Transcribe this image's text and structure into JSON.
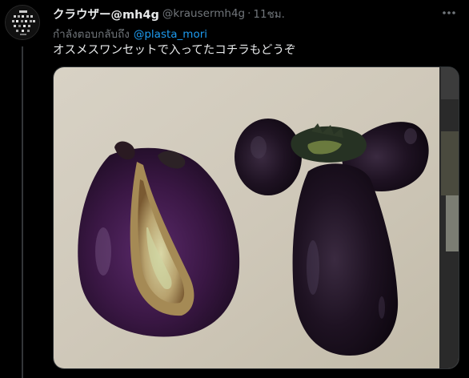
{
  "tweet": {
    "display_name": "クラウザー@mh4g",
    "handle": "@krausermh4g",
    "separator": "·",
    "time": "11ชม.",
    "reply_prefix": "กำลังตอบกลับถึง",
    "reply_to": "@plasta_mori",
    "text": "オスメスワンセットで入ってたコチラもどうぞ"
  },
  "icons": {
    "more": "more-horizontal-icon",
    "avatar": "user-avatar"
  },
  "colors": {
    "background": "#000000",
    "primary_text": "#e7e9ea",
    "secondary_text": "#71767b",
    "link": "#1d9bf0",
    "border": "#2f3336"
  }
}
